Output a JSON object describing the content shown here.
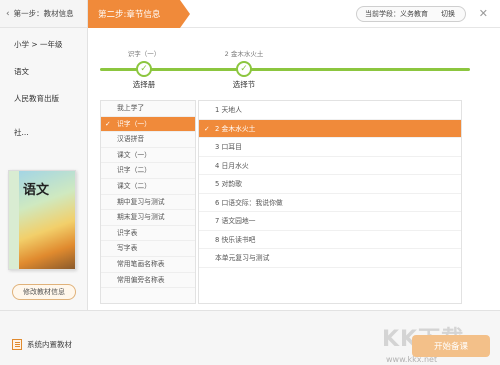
{
  "left": {
    "step1_label": "第一步：教材信息",
    "grade": "小学 > 一年级",
    "subject": "语文",
    "publisher": "人民教育出版社...",
    "cover_title": "语文",
    "modify_button": "修改教材信息"
  },
  "header": {
    "step2_label": "第二步:章节信息",
    "stage_label": "当前学段：",
    "stage_value": "义务教育",
    "switch_label": "切换"
  },
  "steps": [
    {
      "top": "识字（一）",
      "label": "选择册"
    },
    {
      "top": "2 金木水火土",
      "label": "选择节"
    }
  ],
  "categories": [
    "我上学了",
    "识字（一）",
    "汉语拼音",
    "课文（一）",
    "识字（二）",
    "课文（二）",
    "期中复习与测试",
    "期末复习与测试",
    "识字表",
    "写字表",
    "常用笔画名称表",
    "常用偏旁名称表"
  ],
  "selected_category": 1,
  "chapters": [
    "1 天地人",
    "2 金木水火土",
    "3 口耳目",
    "4 日月水火",
    "5 对韵歌",
    "6 口语交际：我说你做",
    "7 语文园地一",
    "8 快乐读书吧",
    "本单元复习与测试"
  ],
  "selected_chapter": 1,
  "bottom": {
    "builtin_label": "系统内置教材",
    "start_button": "开始备课",
    "watermark": "KK下载",
    "watermark_url": "www.kkx.net"
  },
  "colors": {
    "accent": "#f08a3a",
    "progress": "#8cc63f"
  }
}
